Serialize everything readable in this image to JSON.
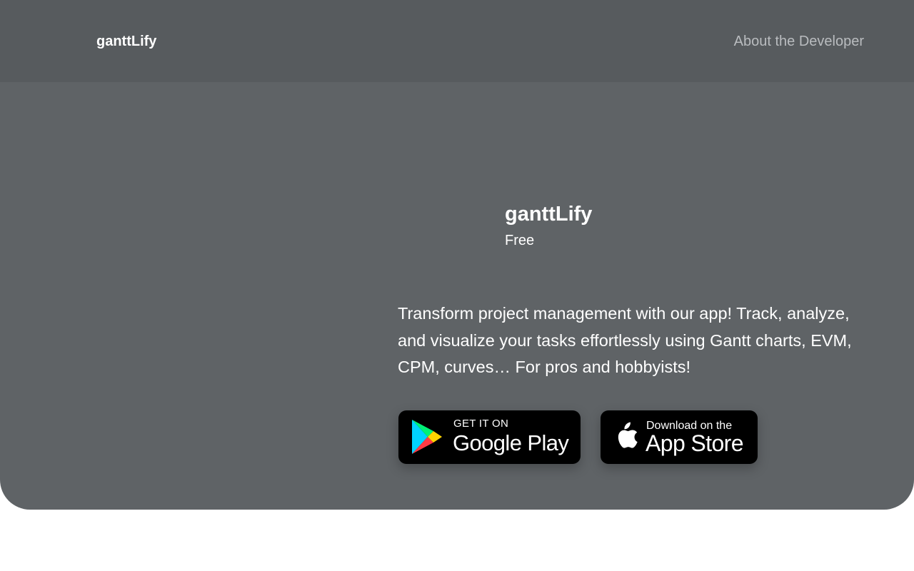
{
  "header": {
    "brand": "ganttLify",
    "nav_link": "About the Developer"
  },
  "app": {
    "name": "ganttLify",
    "price": "Free",
    "description": "Transform project management with our app! Track, analyze, and visualize your tasks effortlessly using Gantt charts, EVM, CPM, curves… For pros and hobbyists!"
  },
  "store_buttons": {
    "google_play": {
      "small": "GET IT ON",
      "big": "Google Play",
      "icon": "google-play-icon"
    },
    "app_store": {
      "small": "Download on the",
      "big": "App Store",
      "icon": "apple-icon"
    }
  },
  "colors": {
    "hero_background": "#5f6366",
    "topbar_background": "#575b5e",
    "nav_link": "#b9bcbf",
    "badge_background": "#000000"
  }
}
